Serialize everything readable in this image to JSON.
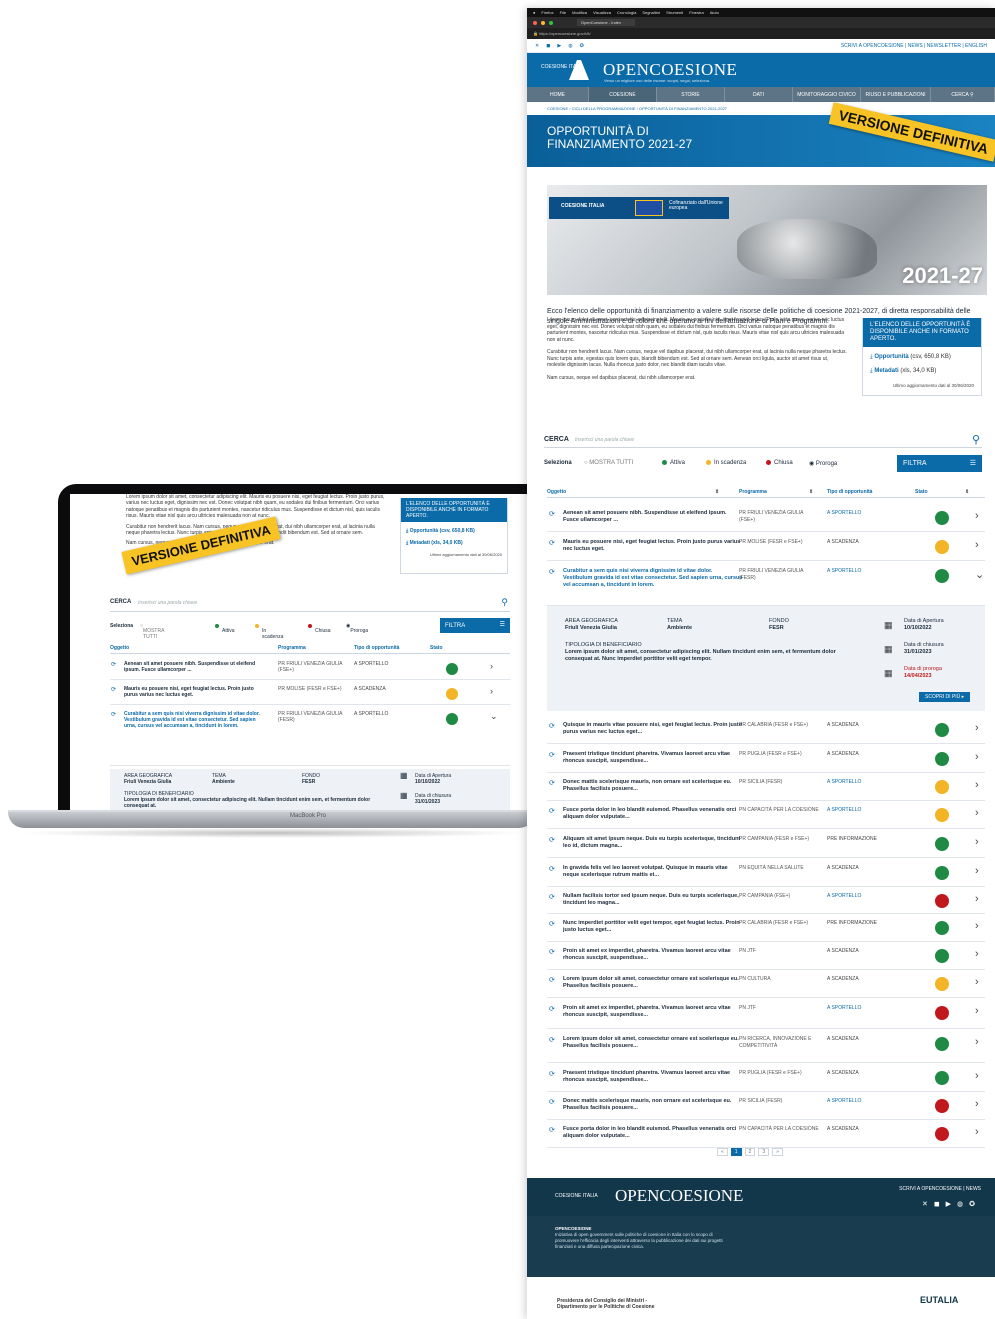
{
  "laptop": {
    "model": "MacBook Pro",
    "text": {
      "p1": "Lorem ipsum dolor sit amet, consectetur adipiscing elit. Mauris eu posuere nisi, eget feugiat lectus. Proin justo purus, varius nec luctus eget, dignissim nec est. Donec volutpat nibh quam, eu sodales dui finibus fermentum. Orci varius natoque penatibus et magnis dis parturient montes, nascetur ridiculus mus. Suspendisse et dictum nisl, quis iaculis risus. Mauris vitae nisl quis arcu ultricies malesuada non at nunc.",
      "p2": "Curabitur non hendrerit lacus. Nam cursus, neque vel dapibus placerat, dui nibh ullamcorper erat, at lacinia nulla neque pharetra lectus. Nunc turpis ante, egestas quis lorem quis, blandit bibendum est. Sed at ornare sem.",
      "p3": "Nam cursus, neque vel dapibus placerat, dui nibh ullamcorper erat."
    },
    "box_head": "L'ELENCO DELLE OPPORTUNITÀ È DISPONIBILE ANCHE IN FORMATO APERTO.",
    "box_link1": "Opportunità (csv, 650,8 KB)",
    "box_link2": "Metadati (xls, 34,0 KB)",
    "box_small": "Ultimo aggiornamento dati al 30/06/2020",
    "banner": "VERSIONE DEFINITIVA",
    "search_label": "CERCA",
    "search_placeholder": "Inserisci una parola chiave",
    "filters": {
      "label": "Seleziona",
      "all": "MOSTRA TUTTI",
      "attiva": "Attiva",
      "scadenza": "In scadenza",
      "chiusa": "Chiusa",
      "proroga": "Proroga",
      "button": "FILTRA"
    },
    "headers": [
      "Oggetto",
      "Programma",
      "Tipo di opportunità",
      "Stato"
    ],
    "rows": [
      {
        "obj": "Aenean sit amet posuere nibh. Suspendisse ut eleifend ipsum. Fusce ullamcorper ...",
        "prog": "PR FRIULI VENEZIA GIULIA (FSE+)",
        "tipo": "A SPORTELLO",
        "stato_color": "#1f8a43"
      },
      {
        "obj": "Mauris eu posuere nisi, eget feugiat lectus. Proin justo purus varius nec luctus eget.",
        "prog": "PR MOLISE (FESR e FSE+)",
        "tipo": "A SCADENZA",
        "stato_color": "#f3b425"
      },
      {
        "obj": "Curabitur a sem quis nisi viverra dignissim id vitae dolor. Vestibulum gravida id est vitae consectetur. Sed sapien urna, cursus vel accumsan a, tincidunt in lorem.",
        "prog": "PR FRIULI VENEZIA GIULIA (FESR)",
        "tipo": "A SPORTELLO",
        "stato_color": "#1f8a43"
      }
    ],
    "detail": {
      "area_label": "AREA GEOGRAFICA",
      "area_value": "Friuli Venezia Giulia",
      "tema_label": "TEMA",
      "tema_value": "Ambiente",
      "fondo_label": "FONDO",
      "fondo_value": "FESR",
      "tipologia_label": "TIPOLOGIA DI BENEFICIARIO",
      "tipologia_value": "Lorem ipsum dolor sit amet, consectetur adipiscing elit. Nullam tincidunt enim sem, et fermentum dolor consequat at.",
      "apertura_label": "Data di Apertura",
      "apertura_value": "10/10/2022",
      "chiusura_label": "Data di chiusura",
      "chiusura_value": "31/01/2023"
    }
  },
  "site": {
    "tab_title": "OpenCoesione - Index",
    "url": "https://opencoesione.gov.it/it/",
    "top_links": "SCRIVI A OPENCOESIONE  |  NEWS  |  NEWSLETTER  |  ENGLISH",
    "brand_small": "COESIONE ITALIA",
    "brand_title": "OPENCOESIONE",
    "brand_tagline": "Verso un migliore uso delle risorse: scopri, segui, seleziona.",
    "nav": [
      "HOME",
      "COESIONE",
      "STORIE",
      "DATI",
      "MONITORAGGIO CIVICO",
      "RIUSO E PUBBLICAZIONI",
      "CERCA"
    ],
    "breadcrumb": "COESIONE › CICLI DELLA PROGRAMMAZIONE › OPPORTUNITÀ DI FINANZIAMENTO 2021-2027",
    "hero_title": "OPPORTUNITÀ DI FINANZIAMENTO 2021-27",
    "hero_banner": "VERSIONE DEFINITIVA",
    "image_eu_text": "Cofinanziato dall'Unione europea",
    "image_year": "2021-27",
    "intro": "Ecco l'elenco delle opportunità di finanziamento a valere sulle risorse delle politiche di coesione 2021-2027, di diretta responsabilità delle singole Amministrazioni e di coloro che operano ai fini dell'attuazione di Piani e Programmi.",
    "body_p1": "Lorem ipsum dolor sit amet, consectetur adipiscing elit. Mauris eu posuere nisi, eget feugiat lectus. Proin justo purus, varius nec luctus eget, dignissim nec est. Donec volutpat nibh quam, eu sodales dui finibus fermentum. Orci varius natoque penatibus et magnis dis parturient montes, nascetur ridiculus mus. Suspendisse et dictum nisl, quis iaculis risus. Mauris vitae nisl quis arcu ultricies malesuada non at nunc.",
    "body_p2": "Curabitur non hendrerit lacus. Nam cursus, neque vel dapibus placerat, dui nibh ullamcorper erat, at lacinia nulla neque pharetra lectus. Nunc turpis ante, egestas quis lorem quis, blandit bibendum est. Sed at ornare sem. Aenean orci ligula, auctor sit amet risus ut, molestie dignissim lacus. Nulla rhoncus justo dolor, nec blandit diam iaculis vitae.",
    "body_p3": "Nam cursus, neque vel dapibus placerat, dui nibh ullamcorper erat.",
    "dl_head": "L'ELENCO DELLE OPPORTUNITÀ È DISPONIBILE ANCHE IN FORMATO APERTO.",
    "dl_link1": "Opportunità",
    "dl_link1_meta": "(csv, 650,8 KB)",
    "dl_link2": "Metadati",
    "dl_link2_meta": "(xls, 34,0 KB)",
    "dl_small": "Ultimo aggiornamento dati al 30/06/2020",
    "search_label": "CERCA",
    "search_placeholder": "Inserisci una parola chiave",
    "filters": {
      "label": "Seleziona",
      "all": "MOSTRA TUTTI",
      "attiva": "Attiva",
      "scadenza": "In scadenza",
      "chiusa": "Chiusa",
      "proroga": "Proroga",
      "button": "FILTRA"
    },
    "headers": [
      "Oggetto",
      "Programma",
      "Tipo di opportunità",
      "Stato"
    ],
    "rows": [
      {
        "obj": "Aenean sit amet posuere nibh. Suspendisse ut eleifend ipsum. Fusce ullamcorper ...",
        "prog": "PR FRIULI VENEZIA GIULIA (FSE+)",
        "tipo": "A SPORTELLO",
        "stato_color": "#1f8a43"
      },
      {
        "obj": "Mauris eu posuere nisi, eget feugiat lectus. Proin justo purus varius nec luctus eget.",
        "prog": "PR MOLISE (FESR e FSE+)",
        "tipo": "A SCADENZA",
        "stato_color": "#f3b425"
      },
      {
        "obj": "Curabitur a sem quis nisi viverra dignissim id vitae dolor. Vestibulum gravida id est vitae consectetur. Sed sapien urna, cursus vel accumsan a, tincidunt in lorem.",
        "prog": "PR FRIULI VENEZIA GIULIA (FESR)",
        "tipo": "A SPORTELLO",
        "stato_color": "#1f8a43"
      },
      {
        "obj": "Quisque in mauris vitae posuere nisi, eget feugiat lectus. Proin justo purus varius nec luctus eget...",
        "prog": "PR CALABRIA (FESR e FSE+)",
        "tipo": "A SCADENZA",
        "stato_color": "#1f8a43"
      },
      {
        "obj": "Praesent tristique tincidunt pharetra. Vivamus laoreet arcu vitae rhoncus suscipit, suspendisse...",
        "prog": "PR PUGLIA (FESR e FSE+)",
        "tipo": "A SCADENZA",
        "stato_color": "#1f8a43"
      },
      {
        "obj": "Donec mattis scelerisque mauris, non ornare est scelerisque eu. Phasellus facilisis posuere...",
        "prog": "PR SICILIA (FESR)",
        "tipo": "A SPORTELLO",
        "stato_color": "#f3b425"
      },
      {
        "obj": "Fusce porta dolor in leo blandit euismod. Phasellus venenatis orci aliquam dolor vulputate...",
        "prog": "PN CAPACITÀ PER LA COESIONE",
        "tipo": "A SPORTELLO",
        "stato_color": "#f3b425"
      },
      {
        "obj": "Aliquam sit amet ipsum neque. Duis eu turpis scelerisque, tincidunt leo id, dictum magna...",
        "prog": "PR CAMPANIA (FESR e FSE+)",
        "tipo": "PRE INFORMAZIONE",
        "stato_color": "#1f8a43"
      },
      {
        "obj": "In gravida felis vel leo laoreet volutpat. Quisque in mauris vitae neque scelerisque rutrum mattis et...",
        "prog": "PN EQUITÀ NELLA SALUTE",
        "tipo": "A SCADENZA",
        "stato_color": "#1f8a43"
      },
      {
        "obj": "Nullam facilisis tortor sed ipsum neque. Duis eu turpis scelerisque, tincidunt leo magna...",
        "prog": "PR CAMPANIA (FSE+)",
        "tipo": "A SPORTELLO",
        "stato_color": "#c0181d"
      },
      {
        "obj": "Nunc imperdiet porttitor velit eget tempor, eget feugiat lectus. Proin justo luctus eget...",
        "prog": "PR CALABRIA (FESR e FSE+)",
        "tipo": "PRE INFORMAZIONE",
        "stato_color": "#1f8a43"
      },
      {
        "obj": "Proin sit amet ex imperdiet, pharetra. Vivamus laoreet arcu vitae rhoncus suscipit, suspendisse...",
        "prog": "PN JTF",
        "tipo": "A SCADENZA",
        "stato_color": "#1f8a43"
      },
      {
        "obj": "Lorem ipsum dolor sit amet, consectetur ornare est scelerisque eu. Phasellus facilisis posuere...",
        "prog": "PN CULTURA",
        "tipo": "A SCADENZA",
        "stato_color": "#f3b425"
      },
      {
        "obj": "Proin sit amet ex imperdiet, pharetra. Vivamus laoreet arcu vitae rhoncus suscipit, suspendisse...",
        "prog": "PN JTF",
        "tipo": "A SPORTELLO",
        "stato_color": "#c0181d"
      },
      {
        "obj": "Lorem ipsum dolor sit amet, consectetur ornare est scelerisque eu. Phasellus facilisis posuere...",
        "prog": "PN RICERCA, INNOVAZIONE E COMPETITIVITÀ",
        "tipo": "A SCADENZA",
        "stato_color": "#1f8a43"
      },
      {
        "obj": "Praesent tristique tincidunt pharetra. Vivamus laoreet arcu vitae rhoncus suscipit, suspendisse...",
        "prog": "PR PUGLIA (FESR e FSE+)",
        "tipo": "A SCADENZA",
        "stato_color": "#1f8a43"
      },
      {
        "obj": "Donec mattis scelerisque mauris, non ornare est scelerisque eu. Phasellus facilisis posuere...",
        "prog": "PR SICILIA (FESR)",
        "tipo": "A SPORTELLO",
        "stato_color": "#c0181d"
      },
      {
        "obj": "Fusce porta dolor in leo blandit euismod. Phasellus venenatis orci aliquam dolor vulputate...",
        "prog": "PN CAPACITÀ PER LA COESIONE",
        "tipo": "A SCADENZA",
        "stato_color": "#c0181d"
      }
    ],
    "detail": {
      "area_label": "AREA GEOGRAFICA",
      "area_value": "Friuli Venezia Giulia",
      "tema_label": "TEMA",
      "tema_value": "Ambiente",
      "fondo_label": "FONDO",
      "fondo_value": "FESR",
      "tipologia_label": "TIPOLOGIA DI BENEFICIARIO",
      "tipologia_value": "Lorem ipsum dolor sit amet, consectetur adipiscing elit. Nullam tincidunt enim sem, et fermentum dolor consequat at. Nunc imperdiet porttitor velit eget tempor.",
      "apertura_label": "Data di Apertura",
      "apertura_value": "10/10/2022",
      "chiusura_label": "Data di chiusura",
      "chiusura_value": "31/01/2023",
      "proroga_label": "Data di proroga",
      "proroga_value": "14/04/2023",
      "more": "SCOPRI DI PIÙ ▸"
    },
    "pager": [
      "«",
      "1",
      "2",
      "3",
      "»"
    ],
    "footer": {
      "brand_small": "COESIONE ITALIA",
      "title": "OPENCOESIONE",
      "links": "SCRIVI A OPENCOESIONE  |  NEWS",
      "desc_title": "OPENCOESIONE",
      "desc": "Iniziativa di open government sulle politiche di coesione in Italia con lo scopo di promuovere l'efficacia degli interventi attraverso la pubblicazione dei dati sui progetti finanziati e una diffusa partecipazione civica.",
      "partner1": "Presidenza del Consiglio dei Ministri - Dipartimento per le Politiche di Coesione",
      "partner2": "EUTALIA"
    },
    "colors": {
      "brand": "#0b6aa8",
      "attiva": "#1f8a43",
      "scadenza": "#f3b425",
      "chiusa": "#c0181d",
      "banner": "#f7c325"
    }
  }
}
